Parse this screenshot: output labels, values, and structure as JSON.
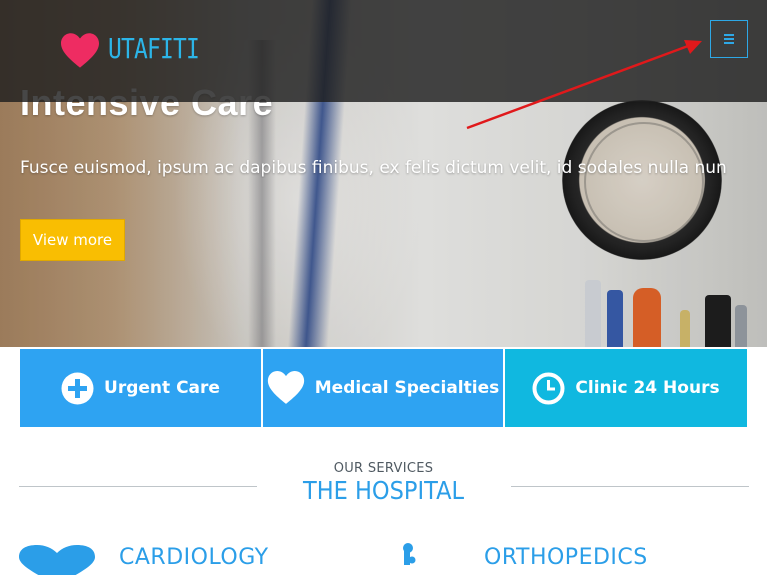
{
  "header": {
    "logo_text": "UTAFITI",
    "menu_icon": "hamburger-icon"
  },
  "hero": {
    "title": "Intensive Care",
    "text": "Fusce euismod, ipsum ac dapibus finibus, ex felis dictum velit, id sodales nulla nun",
    "button_label": "View more"
  },
  "features": [
    {
      "label": "Urgent Care",
      "icon": "plus-circle-icon",
      "color": "#2ea3f2"
    },
    {
      "label": "Medical Specialties",
      "icon": "heart-icon",
      "color": "#2ea3f2"
    },
    {
      "label": "Clinic 24 Hours",
      "icon": "clock-icon",
      "color": "#10b8e0"
    }
  ],
  "services": {
    "subtitle": "OUR SERVICES",
    "title": "THE HOSPITAL",
    "cards": [
      {
        "title": "CARDIOLOGY",
        "icon": "heart-icon"
      },
      {
        "title": "ORTHOPEDICS",
        "icon": "bone-icon"
      }
    ]
  },
  "colors": {
    "accent": "#2b9ee8",
    "logo_heart": "#ee2c62",
    "button": "#f9be02",
    "annotation_arrow": "#e0191b"
  }
}
